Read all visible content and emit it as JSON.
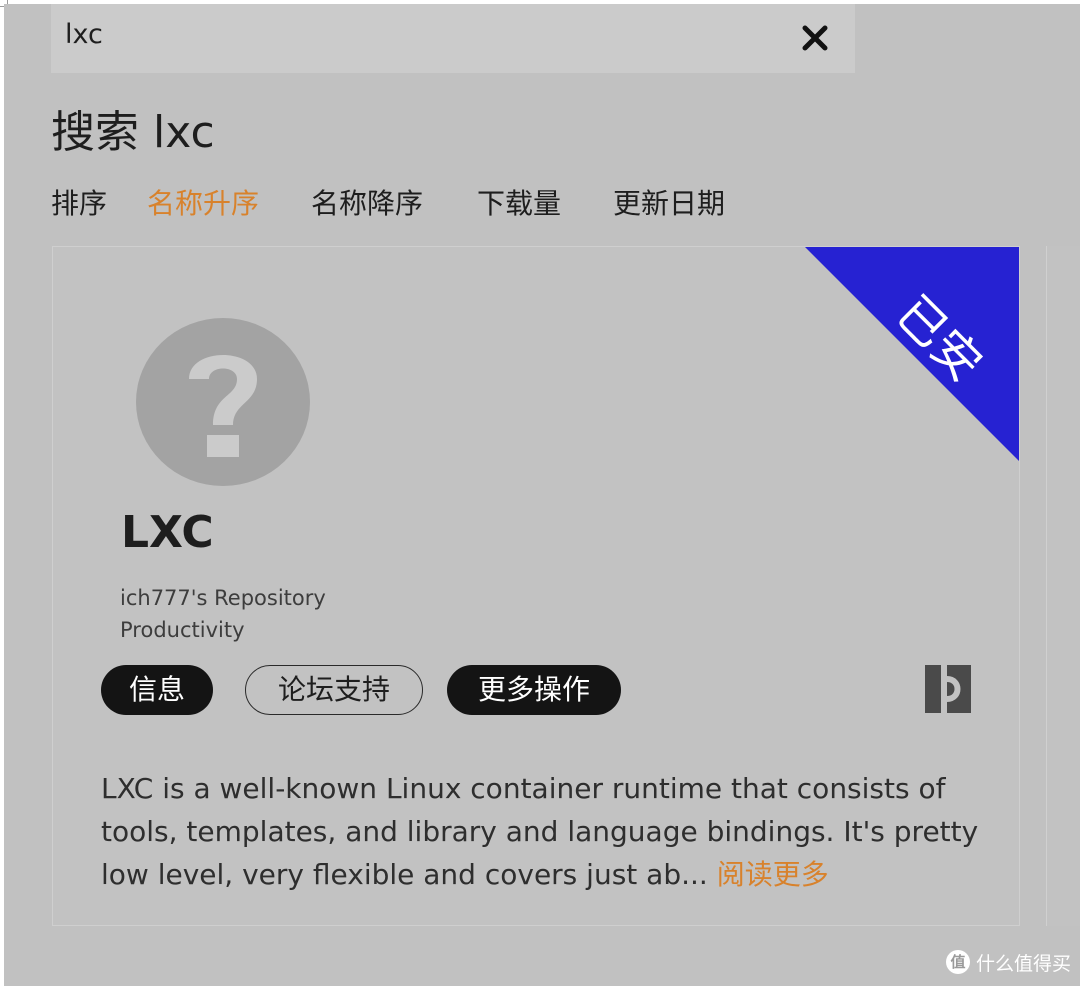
{
  "search": {
    "value": "lxc"
  },
  "page_title": "搜索 lxc",
  "sort": {
    "label": "排序",
    "options": [
      "名称升序",
      "名称降序",
      "下载量",
      "更新日期"
    ],
    "active_index": 0
  },
  "app": {
    "ribbon_label": "已安",
    "name": "LXC",
    "repository": "ich777's Repository",
    "category": "Productivity",
    "buttons": {
      "info": "信息",
      "forum": "论坛支持",
      "more": "更多操作"
    },
    "description": "LXC is a well-known Linux container runtime that consists of tools, templates, and library and language bindings. It's pretty low level, very flexible and covers just ab...",
    "read_more": "阅读更多"
  },
  "watermark": {
    "badge": "值",
    "text": "什么值得买"
  },
  "colors": {
    "accent": "#d8822c",
    "ribbon": "#2622d2",
    "background": "#c1c1c1",
    "pill_dark": "#141414"
  },
  "icons": {
    "close": "close-icon",
    "app_placeholder": "question-mark-icon",
    "docker_hub": "docker-hub-icon"
  }
}
